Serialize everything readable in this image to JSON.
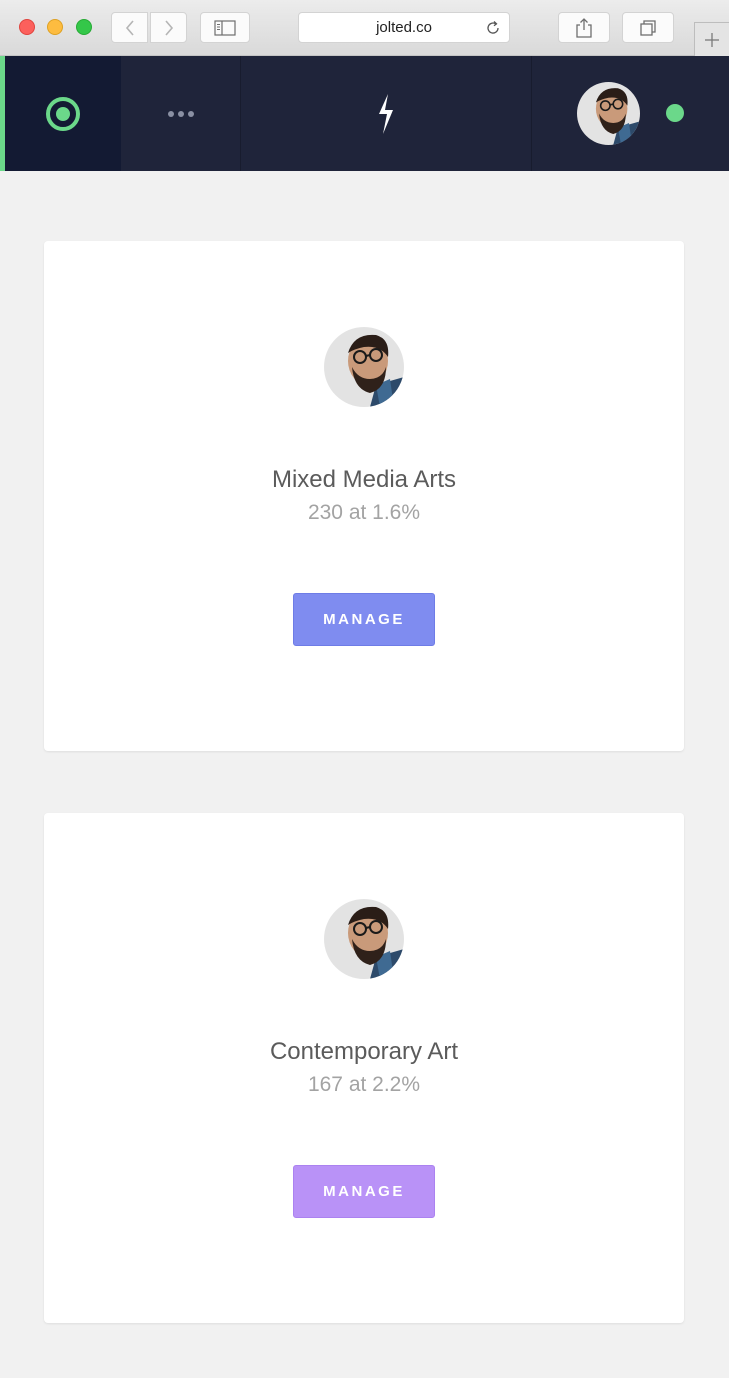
{
  "browser": {
    "url": "jolted.co"
  },
  "nav": {
    "home_icon": "target-icon",
    "more_icon": "more-dots-icon",
    "logo_icon": "bolt-logo-icon",
    "status": "online",
    "colors": {
      "bar": "#1f243a",
      "active": "#131a33",
      "accent": "#6bd88a"
    }
  },
  "cards": [
    {
      "title": "Mixed Media Arts",
      "stat": "230 at 1.6%",
      "button": "MANAGE",
      "button_color": "#7f8cf0"
    },
    {
      "title": "Contemporary Art",
      "stat": "167 at 2.2%",
      "button": "MANAGE",
      "button_color": "#b992f7"
    }
  ]
}
